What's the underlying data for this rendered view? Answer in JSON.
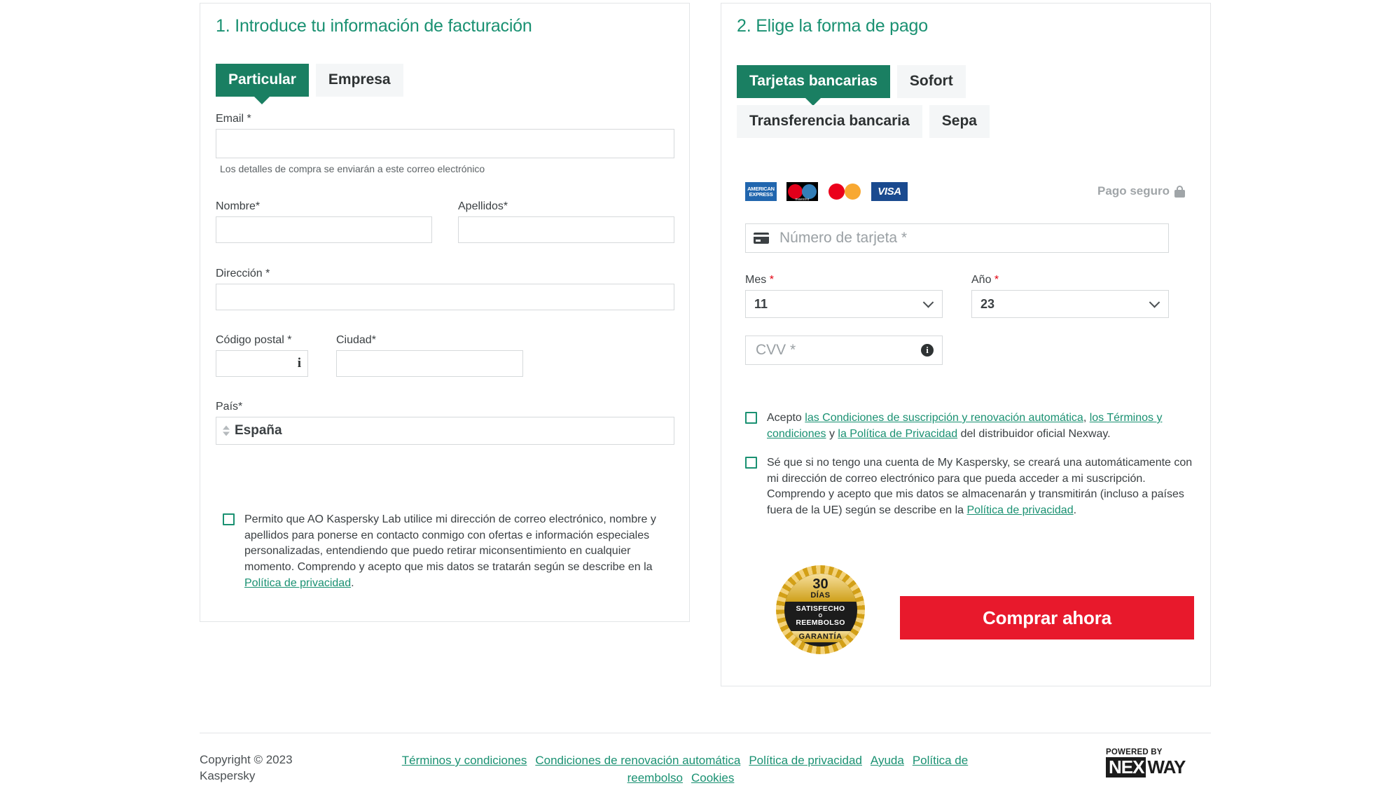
{
  "billing": {
    "title": "1. Introduce tu información de facturación",
    "tabs": [
      {
        "label": "Particular",
        "active": true
      },
      {
        "label": "Empresa",
        "active": false
      }
    ],
    "email": {
      "label": "Email *",
      "value": "",
      "helper": "Los detalles de compra se enviarán a este correo electrónico"
    },
    "first_name": {
      "label": "Nombre*",
      "value": ""
    },
    "last_name": {
      "label": "Apellidos*",
      "value": ""
    },
    "address": {
      "label": "Dirección *",
      "value": ""
    },
    "postal_code": {
      "label": "Código postal *",
      "value": "",
      "info_icon": "info-i-icon"
    },
    "city": {
      "label": "Ciudad*",
      "value": ""
    },
    "country": {
      "label": "País*",
      "value": "España"
    },
    "consent": {
      "checked": false,
      "part1": "Permito que AO Kaspersky Lab utilice mi dirección de correo electrónico, nombre y apellidos para ponerse en contacto conmigo con ofertas e información especiales personalizadas, entendiendo que puedo retirar miconsentimiento en cualquier momento. Comprendo y acepto que mis datos se tratarán según se describe en la ",
      "link": "Política de privacidad",
      "part2": "."
    }
  },
  "payment": {
    "title": "2. Elige la forma de pago",
    "tabs": [
      {
        "label": "Tarjetas bancarias",
        "active": true
      },
      {
        "label": "Sofort",
        "active": false
      },
      {
        "label": "Transferencia bancaria",
        "active": false
      },
      {
        "label": "Sepa",
        "active": false
      }
    ],
    "card_logos": [
      "american-express",
      "maestro",
      "mastercard",
      "visa"
    ],
    "amex_line1": "AMERICAN",
    "amex_line2": "EXPRESS",
    "maestro_label": "maestro",
    "visa_label": "VISA",
    "secure_label": "Pago seguro",
    "card_number": {
      "placeholder": "Número de tarjeta *",
      "value": ""
    },
    "month": {
      "label": "Mes",
      "required_mark": "*",
      "value": "11"
    },
    "year": {
      "label": "Año",
      "required_mark": "*",
      "value": "23"
    },
    "cvv": {
      "placeholder": "CVV *",
      "value": ""
    },
    "terms_consent": {
      "checked": false,
      "t1": "Acepto ",
      "l1": "las Condiciones de suscripción y renovación automática",
      "t2": ", ",
      "l2": "los Términos y condiciones",
      "t3": " y ",
      "l3": "la Política de Privacidad",
      "t4": " del distribuidor oficial Nexway."
    },
    "account_consent": {
      "checked": false,
      "t1": "Sé que si no tengo una cuenta de My Kaspersky, se creará una automáticamente con mi dirección de correo electrónico para que pueda acceder a mi suscripción. Comprendo y acepto que mis datos se almacenarán y transmitirán (incluso a países fuera de la UE) según se describe en la ",
      "l1": "Política de privacidad",
      "t2": "."
    },
    "guarantee_badge": {
      "days": "30",
      "days_label": "DÍAS",
      "line1": "SATISFECHO",
      "line_o": "O",
      "line2": "REEMBOLSO",
      "bottom": "GARANTÍA"
    },
    "buy_button": "Comprar ahora"
  },
  "footer": {
    "copyright": "Copyright © 2023 Kaspersky",
    "links": [
      "Términos y condiciones",
      "Condiciones de renovación automática",
      "Política de privacidad",
      "Ayuda",
      "Política de reembolso",
      "Cookies"
    ],
    "powered_by": "POWERED BY",
    "brand_part1": "NEX",
    "brand_part2": "WAY"
  },
  "colors": {
    "brand_green": "#1a9172",
    "tab_active": "#1a7f62",
    "buy_red": "#e8192c",
    "required_red": "#e3000f"
  }
}
